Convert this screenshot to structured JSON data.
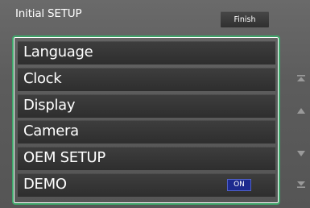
{
  "header": {
    "title": "Initial SETUP",
    "finish_label": "Finish"
  },
  "menu": {
    "items": [
      {
        "label": "Language"
      },
      {
        "label": "Clock"
      },
      {
        "label": "Display"
      },
      {
        "label": "Camera"
      },
      {
        "label": "OEM SETUP"
      },
      {
        "label": "DEMO",
        "badge": "ON"
      }
    ]
  },
  "scroll": {
    "icons": [
      "scroll-to-top-icon",
      "scroll-up-icon",
      "scroll-down-icon",
      "scroll-to-bottom-icon"
    ]
  },
  "colors": {
    "highlight_border": "#3fa66a",
    "badge_bg": "#1c2a8e"
  }
}
